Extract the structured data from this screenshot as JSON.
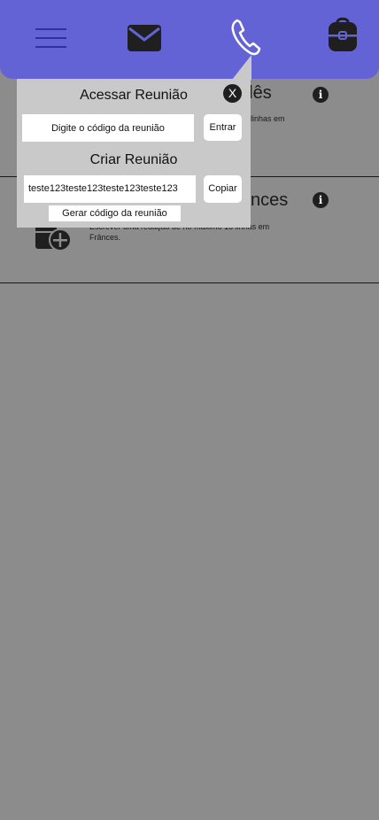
{
  "nav": {
    "items": [
      {
        "icon": "menu-icon"
      },
      {
        "icon": "mail-icon"
      },
      {
        "icon": "phone-icon"
      },
      {
        "icon": "backpack-icon"
      }
    ],
    "accent": "#6363d6",
    "icon_color": "#1f1f1f"
  },
  "rows": [
    {
      "title": "glês",
      "description": "linhas em",
      "icon": "info-icon"
    },
    {
      "title": "nces",
      "description": "Escrever uma redação de no máximo 15 linhas em Frânces.",
      "icon": "info-icon"
    }
  ],
  "popup": {
    "access_title": "Acessar Reunião",
    "code_placeholder": "Digite o código da reunião",
    "enter_label": "Entrar",
    "create_title": "Criar Reunião",
    "generated_code": "teste123teste123teste123teste123",
    "copy_label": "Copiar",
    "generate_label": "Gerar código da reunião",
    "close_label": "X"
  }
}
